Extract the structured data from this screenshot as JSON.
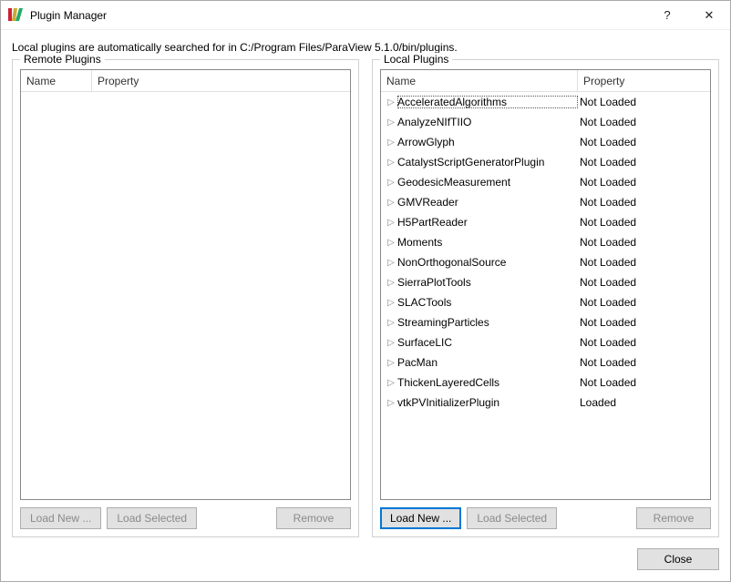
{
  "window": {
    "title": "Plugin Manager",
    "help_symbol": "?",
    "close_symbol": "✕"
  },
  "info_text": "Local plugins are automatically searched for in C:/Program Files/ParaView 5.1.0/bin/plugins.",
  "headers": {
    "name": "Name",
    "property": "Property"
  },
  "groups": {
    "remote": {
      "legend": "Remote Plugins"
    },
    "local": {
      "legend": "Local Plugins"
    }
  },
  "buttons": {
    "load_new": "Load New ...",
    "load_selected": "Load Selected",
    "remove": "Remove",
    "close": "Close"
  },
  "remote_plugins": [],
  "local_plugins": [
    {
      "name": "AcceleratedAlgorithms",
      "property": "Not Loaded",
      "focused": true
    },
    {
      "name": "AnalyzeNIfTIIO",
      "property": "Not Loaded"
    },
    {
      "name": "ArrowGlyph",
      "property": "Not Loaded"
    },
    {
      "name": "CatalystScriptGeneratorPlugin",
      "property": "Not Loaded"
    },
    {
      "name": "GeodesicMeasurement",
      "property": "Not Loaded"
    },
    {
      "name": "GMVReader",
      "property": "Not Loaded"
    },
    {
      "name": "H5PartReader",
      "property": "Not Loaded"
    },
    {
      "name": "Moments",
      "property": "Not Loaded"
    },
    {
      "name": "NonOrthogonalSource",
      "property": "Not Loaded"
    },
    {
      "name": "SierraPlotTools",
      "property": "Not Loaded"
    },
    {
      "name": "SLACTools",
      "property": "Not Loaded"
    },
    {
      "name": "StreamingParticles",
      "property": "Not Loaded"
    },
    {
      "name": "SurfaceLIC",
      "property": "Not Loaded"
    },
    {
      "name": "PacMan",
      "property": "Not Loaded"
    },
    {
      "name": "ThickenLayeredCells",
      "property": "Not Loaded"
    },
    {
      "name": "vtkPVInitializerPlugin",
      "property": "Loaded"
    }
  ]
}
